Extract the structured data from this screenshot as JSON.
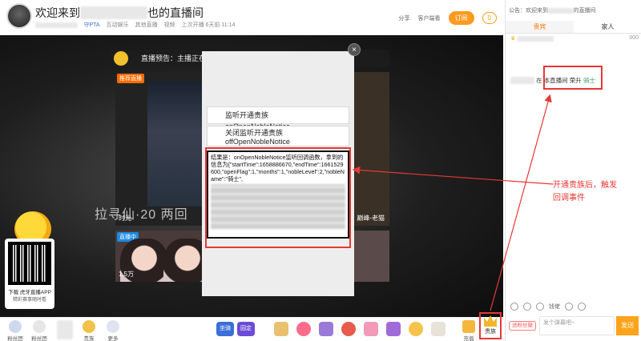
{
  "header": {
    "title_prefix": "欢迎来到",
    "title_suffix": "也的直播间",
    "tag_pta": "守PTA",
    "category": "互动娱乐",
    "sub_category": "其他直播",
    "video_label": "视频",
    "last_live": "上次开播 6天前 11:14",
    "share_label": "分享",
    "client_label": "客户端看",
    "subscribe_label": "订阅",
    "subscribe_count": "0"
  },
  "video": {
    "preview_label": "直播预告：主播正在赶来",
    "tile_badge_recommend": "推荐直播",
    "tile_badge_live": "直播中",
    "tile_left_caption": "时光",
    "tile_right_caption": "巅峰-老猫",
    "overlay_text": "拉寻仙·20 两回",
    "viewer_count": "1.5万"
  },
  "modal": {
    "btn_open": "监听开通贵族onOpenNobleNotice",
    "btn_close_line1": "关闭监听开通贵族",
    "btn_close_line2": "offOpenNobleNotice",
    "result_text": "结果是：onOpenNobleNotice监听回调函数，拿到的信息为{\"startTime\":1658886670,\"endTime\":1661529600,\"openFlag\":1,\"months\":1,\"nobleLevel\":2,\"nobleName\":\"骑士\",",
    "close_symbol": "×"
  },
  "qr": {
    "line1": "下载 虎牙直播APP",
    "line2": "精彩赛事随时看"
  },
  "toolbar": {
    "fans_group": "粉丝团",
    "fans_club": "粉丝团",
    "noble": "贵族",
    "more": "更多",
    "recharge": "充值",
    "noble_btn": "贵族",
    "gift_badge_1": "坐骑",
    "gift_badge_2": "园定"
  },
  "panel": {
    "announce": "公告：欢迎来到",
    "announce_suffix": "的直播间",
    "tab_vip": "贵宾",
    "tab_family": "家人",
    "rank_value": "000",
    "chat_prefix": "在 本直播间 荣升",
    "chat_highlight": "骑士",
    "tool_label": "钱佬",
    "fan_badge": "送粉丝徽",
    "input_placeholder": "发个弹幕吧~",
    "send_label": "发送"
  },
  "annotation": {
    "text": "开通贵族后，触发回调事件"
  },
  "colors": {
    "accent": "#ff9a1f",
    "annotation_red": "#e53935",
    "highlight_green": "#3ba55d"
  }
}
